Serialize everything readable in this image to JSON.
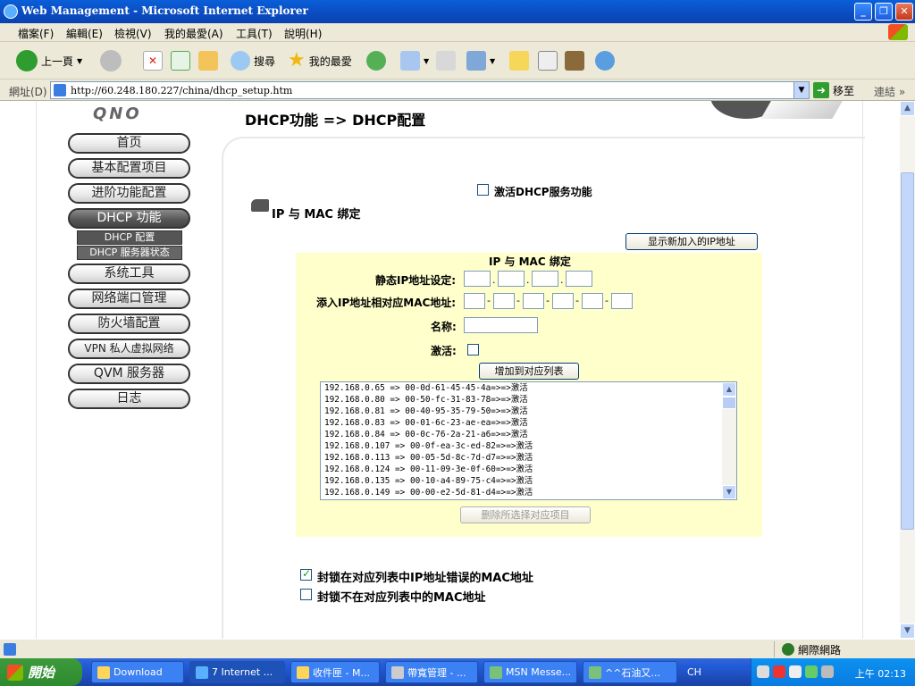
{
  "window": {
    "title": "Web Management - Microsoft Internet Explorer",
    "buttons": {
      "minimize": "_",
      "maximize": "❐",
      "close": "✕"
    }
  },
  "menu": [
    "檔案(F)",
    "編輯(E)",
    "檢視(V)",
    "我的最愛(A)",
    "工具(T)",
    "說明(H)"
  ],
  "toolbar": {
    "back_label": "上一頁",
    "search_label": "搜尋",
    "favorites_label": "我的最愛"
  },
  "address": {
    "label": "網址(D)",
    "url": "http://60.248.180.227/china/dhcp_setup.htm",
    "go_label": "移至",
    "links_label": "連結"
  },
  "page": {
    "brand": "QNO",
    "title": "DHCP功能  => DHCP配置"
  },
  "nav": {
    "items": [
      {
        "label": "首页",
        "active": false
      },
      {
        "label": "基本配置项目",
        "active": false
      },
      {
        "label": "进阶功能配置",
        "active": false
      },
      {
        "label": "DHCP 功能",
        "active": true
      },
      {
        "label": "系统工具",
        "active": false
      },
      {
        "label": "网络端口管理",
        "active": false
      },
      {
        "label": "防火墙配置",
        "active": false
      },
      {
        "label": "VPN 私人虚拟网络",
        "active": false
      },
      {
        "label": "QVM 服务器",
        "active": false
      },
      {
        "label": "日志",
        "active": false
      }
    ],
    "subitems": [
      "DHCP 配置",
      "DHCP 服务器状态"
    ]
  },
  "form": {
    "enable_dhcp_label": "激活DHCP服务功能",
    "enable_dhcp_checked": false,
    "section_title": "IP 与  MAC 绑定",
    "show_new_ip_button": "显示新加入的IP地址",
    "panel_title": "IP 与  MAC 绑定",
    "static_ip_label": "静态IP地址设定:",
    "mac_label": "添入IP地址相对应MAC地址:",
    "name_label": "名称:",
    "activate_label": "激活:",
    "add_button": "增加到对应列表",
    "delete_button": "删除所选择对应项目",
    "list_entries": [
      "192.168.0.65 => 00-0d-61-45-45-4a=>=>激活",
      "192.168.0.80 => 00-50-fc-31-83-78=>=>激活",
      "192.168.0.81 => 00-40-95-35-79-50=>=>激活",
      "192.168.0.83 => 00-01-6c-23-ae-ea=>=>激活",
      "192.168.0.84 => 00-0c-76-2a-21-a6=>=>激活",
      "192.168.0.107 => 00-0f-ea-3c-ed-82=>=>激活",
      "192.168.0.113 => 00-05-5d-8c-7d-d7=>=>激活",
      "192.168.0.124 => 00-11-09-3e-0f-60=>=>激活",
      "192.168.0.135 => 00-10-a4-89-75-c4=>=>激活",
      "192.168.0.149 => 00-00-e2-5d-81-d4=>=>激活"
    ],
    "lock_wrong_mac_label": "封锁在对应列表中IP地址错误的MAC地址",
    "lock_wrong_mac_checked": true,
    "lock_unlisted_mac_label": "封锁不在对应列表中的MAC地址",
    "lock_unlisted_mac_checked": false
  },
  "status": {
    "zone": "網際網路"
  },
  "taskbar": {
    "start_label": "開始",
    "tasks": [
      "Download",
      "7 Internet ...",
      "收件匣 - M...",
      "帶寬管理 - ...",
      "MSN Messe...",
      "^^石油又..."
    ],
    "lang": "CH",
    "clock": "上午 02:13"
  }
}
